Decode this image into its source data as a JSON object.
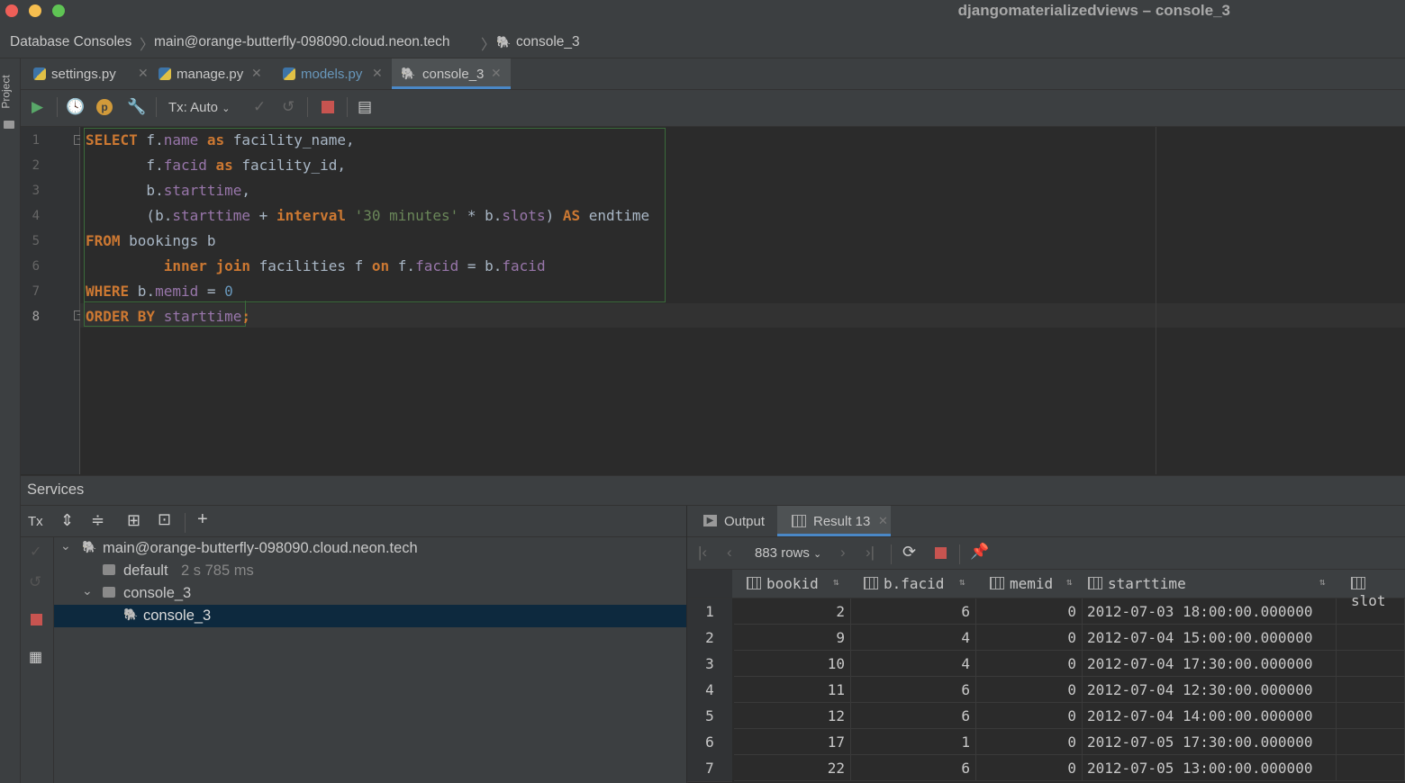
{
  "window": {
    "title": "djangomaterializedviews – console_3"
  },
  "breadcrumb": {
    "items": [
      "Database Consoles",
      "main@orange-butterfly-098090.cloud.neon.tech",
      "console_3"
    ]
  },
  "sidebar": {
    "project_label": "Project"
  },
  "tabs": [
    {
      "label": "settings.py"
    },
    {
      "label": "manage.py"
    },
    {
      "label": "models.py"
    },
    {
      "label": "console_3"
    }
  ],
  "toolbar": {
    "tx_mode": "Tx: Auto"
  },
  "editor": {
    "line_numbers": [
      "1",
      "2",
      "3",
      "4",
      "5",
      "6",
      "7",
      "8"
    ],
    "lines": [
      {
        "kw1": "SELECT",
        "p1": " f.",
        "f1": "name",
        "s1": " ",
        "kw2": "as",
        "p2": " facility_name,"
      },
      {
        "indent": "       f.",
        "f1": "facid",
        "s1": " ",
        "kw2": "as",
        "p2": " facility_id,"
      },
      {
        "indent": "       b.",
        "f1": "starttime",
        "p2": ","
      },
      {
        "indent": "       (b.",
        "f1": "starttime",
        "p1": " + ",
        "kw1": "interval",
        "s1": " ",
        "str": "'30 minutes'",
        "p2": " * b.",
        "f2": "slots",
        "p3": ") ",
        "kw2": "AS",
        "p4": " endtime"
      },
      {
        "kw1": "FROM",
        "p1": " bookings b"
      },
      {
        "indent": "         ",
        "kw1": "inner join",
        "p1": " facilities f ",
        "kw2": "on",
        "p2": " f.",
        "f1": "facid",
        "p3": " = b.",
        "f2": "facid"
      },
      {
        "kw1": "WHERE",
        "p1": " b.",
        "f1": "memid",
        "p2": " = ",
        "num": "0"
      },
      {
        "kw1": "ORDER BY",
        "p1": " ",
        "f1": "starttime",
        "p2": ";"
      }
    ]
  },
  "services": {
    "title": "Services",
    "tx_label": "Tx",
    "tree": [
      {
        "label": "main@orange-butterfly-098090.cloud.neon.tech"
      },
      {
        "label": "default",
        "meta": "2 s 785 ms"
      },
      {
        "label": "console_3"
      },
      {
        "label": "console_3"
      }
    ]
  },
  "results": {
    "tabs": [
      "Output",
      "Result 13"
    ],
    "rows_label": "883 rows",
    "columns": [
      "bookid",
      "b.facid",
      "memid",
      "starttime",
      "slot"
    ],
    "rows": [
      {
        "n": "1",
        "bookid": "2",
        "facid": "6",
        "memid": "0",
        "starttime": "2012-07-03 18:00:00.000000"
      },
      {
        "n": "2",
        "bookid": "9",
        "facid": "4",
        "memid": "0",
        "starttime": "2012-07-04 15:00:00.000000"
      },
      {
        "n": "3",
        "bookid": "10",
        "facid": "4",
        "memid": "0",
        "starttime": "2012-07-04 17:30:00.000000"
      },
      {
        "n": "4",
        "bookid": "11",
        "facid": "6",
        "memid": "0",
        "starttime": "2012-07-04 12:30:00.000000"
      },
      {
        "n": "5",
        "bookid": "12",
        "facid": "6",
        "memid": "0",
        "starttime": "2012-07-04 14:00:00.000000"
      },
      {
        "n": "6",
        "bookid": "17",
        "facid": "1",
        "memid": "0",
        "starttime": "2012-07-05 17:30:00.000000"
      },
      {
        "n": "7",
        "bookid": "22",
        "facid": "6",
        "memid": "0",
        "starttime": "2012-07-05 13:00:00.000000"
      }
    ]
  }
}
